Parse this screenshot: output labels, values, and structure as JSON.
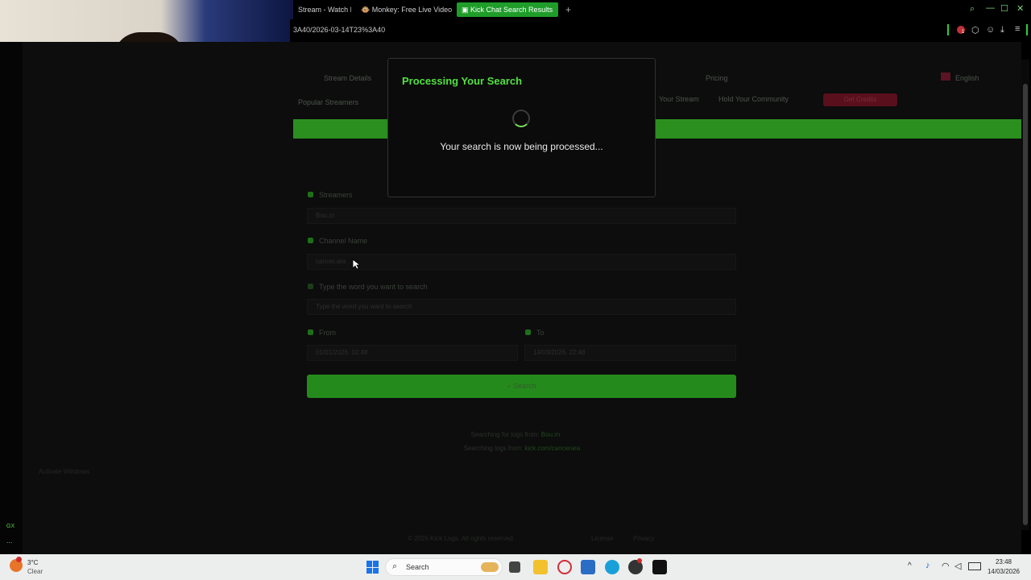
{
  "browser": {
    "tabs": [
      {
        "label": "Stream - Watch L",
        "active": false
      },
      {
        "label": "Monkey: Free Live Video C",
        "active": false
      },
      {
        "label": "Kick Chat Search Results",
        "active": true
      }
    ],
    "new_tab_label": "+",
    "url": "3A40/2026-03-14T23%3A40",
    "extension_badge": "1"
  },
  "site": {
    "nav": [
      "Stream Details",
      "Pricing",
      "English"
    ],
    "subnav": [
      "Popular Streamers",
      "Your Stream",
      "Hold Your Community"
    ],
    "cta_label": "Get Credits",
    "form": {
      "streamer_label": "Streamers",
      "streamer_value": "Bou.rn",
      "channel_label": "Channel Name",
      "channel_value": "cancer.ara",
      "word_label": "Type the word you want to search",
      "word_placeholder": "Type the word you want to search",
      "from_label": "From",
      "from_value": "01/01/2026, 02:48",
      "to_label": "To",
      "to_value": "14/03/2026, 22:48",
      "search_label": "Search"
    },
    "footer_line1_prefix": "Searching for logs from:",
    "footer_line1_link": "Bou.rn",
    "footer_line2_prefix": "Searching logs from:",
    "footer_line2_link": "kick.com/cancerara",
    "copyright": "© 2026 Kick Logs. All rights reserved.",
    "footer_links": [
      "License",
      "Privacy"
    ],
    "left_hint": "Activate Windows"
  },
  "modal": {
    "title": "Processing Your Search",
    "message": "Your search is now being processed..."
  },
  "sidebar": {
    "gx_label": "GX",
    "more_label": "..."
  },
  "taskbar": {
    "weather_temp": "3°C",
    "weather_desc": "Clear",
    "search_placeholder": "Search",
    "time": "23:48",
    "date": "14/03/2026"
  },
  "colors": {
    "accent": "#53e042",
    "tab_active": "#1f9d2a",
    "band": "#2a8f1f"
  }
}
